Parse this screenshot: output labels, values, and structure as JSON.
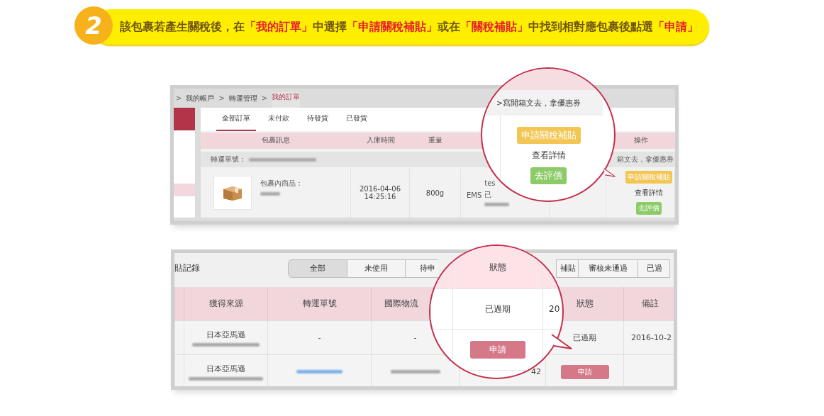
{
  "instruction": {
    "step": "2",
    "segments": [
      {
        "text": "該包裹若產生關稅後，在",
        "highlight": false
      },
      {
        "text": "「我的訂單」",
        "highlight": true
      },
      {
        "text": "中選擇",
        "highlight": false
      },
      {
        "text": "「申請關稅補貼」",
        "highlight": true
      },
      {
        "text": "或在",
        "highlight": false
      },
      {
        "text": "「關稅補貼」",
        "highlight": true
      },
      {
        "text": "中找到相對應包裹後點選",
        "highlight": false
      },
      {
        "text": "「申請」",
        "highlight": true
      }
    ]
  },
  "orders_screenshot": {
    "breadcrumb": [
      {
        "text": ">",
        "kind": "separator"
      },
      {
        "text": "我的帳戶",
        "kind": "link",
        "selected": false
      },
      {
        "text": ">",
        "kind": "separator"
      },
      {
        "text": "轉運管理",
        "kind": "link",
        "selected": false
      },
      {
        "text": ">",
        "kind": "separator"
      },
      {
        "text": "我的訂單",
        "kind": "link",
        "selected": true
      }
    ],
    "tabs": [
      {
        "label": "全部訂單",
        "selected": true
      },
      {
        "label": "未付款",
        "selected": false
      },
      {
        "label": "待發貨",
        "selected": false
      },
      {
        "label": "已發貨",
        "selected": false
      }
    ],
    "columns": [
      "包裹訊息",
      "入庫時間",
      "重量",
      "操作"
    ],
    "order_number_label": "轉運單號：",
    "row": {
      "contents_label": "包裹內商品：",
      "stock_time": "2016-04-06 14:25:16",
      "weight": "800g",
      "carrier": "EMS",
      "note_fragment": "tes",
      "status_fragment": "已",
      "review_link": "箱文去，拿優惠券",
      "actions": [
        {
          "label": "申請關稅補貼",
          "kind": "subsidy"
        },
        {
          "label": "查看詳情",
          "kind": "link"
        },
        {
          "label": "去評價",
          "kind": "review"
        }
      ]
    },
    "magnifier": {
      "review_link": ">寫開箱文去，拿優惠券",
      "actions": [
        {
          "label": "申請關稅補貼",
          "kind": "subsidy"
        },
        {
          "label": "查看詳情",
          "kind": "link"
        },
        {
          "label": "去評價",
          "kind": "review"
        }
      ]
    }
  },
  "subsidy_screenshot": {
    "title": "貼記錄",
    "tabs": [
      {
        "label": "全部",
        "selected": true
      },
      {
        "label": "未使用",
        "selected": false
      },
      {
        "label": "待申",
        "selected": false
      },
      {
        "label": "補貼",
        "selected": false
      },
      {
        "label": "審核未通過",
        "selected": false
      },
      {
        "label": "已過",
        "selected": false
      }
    ],
    "columns": [
      "獲得來源",
      "轉運單號",
      "國際物流",
      "狀態",
      "備註"
    ],
    "rows": [
      {
        "source": "日本亞馬遜",
        "order_no": "-",
        "logistics_no": "-",
        "status": "已過期",
        "note": "2016-10-2"
      },
      {
        "source": "日本亞馬遜",
        "fragment": "42",
        "action": "申請"
      }
    ],
    "magnifier": {
      "column": "狀態",
      "status": "已過期",
      "fragment": "20",
      "action": "申請"
    }
  }
}
